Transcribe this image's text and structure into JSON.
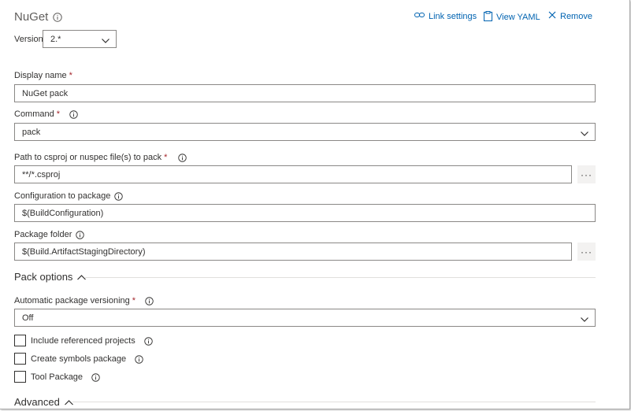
{
  "task": {
    "title": "NuGet",
    "actions": {
      "link_settings": "Link settings",
      "view_yaml": "View YAML",
      "remove": "Remove"
    },
    "version_label": "Version",
    "version_value": "2.*"
  },
  "fields": {
    "display_name": {
      "label": "Display name",
      "required": "*",
      "value": "NuGet pack"
    },
    "command": {
      "label": "Command",
      "required": "*",
      "value": "pack"
    },
    "path": {
      "label": "Path to csproj or nuspec file(s) to pack",
      "required": "*",
      "value": "**/*.csproj",
      "browse": "···"
    },
    "configuration": {
      "label": "Configuration to package",
      "value": "$(BuildConfiguration)"
    },
    "package_folder": {
      "label": "Package folder",
      "value": "$(Build.ArtifactStagingDirectory)",
      "browse": "···"
    }
  },
  "pack_options": {
    "title": "Pack options",
    "versioning": {
      "label": "Automatic package versioning",
      "required": "*",
      "value": "Off"
    },
    "checkboxes": [
      {
        "label": "Include referenced projects",
        "checked": false
      },
      {
        "label": "Create symbols package",
        "checked": false
      },
      {
        "label": "Tool Package",
        "checked": false
      }
    ]
  },
  "advanced": {
    "title": "Advanced"
  },
  "icons": {
    "info": "info-icon",
    "link": "link-icon",
    "yaml": "clipboard-icon",
    "remove": "close-icon",
    "dropdown": "chevron-down-icon",
    "collapse": "chevron-up-icon"
  },
  "colors": {
    "accent": "#0063b1",
    "required": "#a4262c",
    "border": "#8a8886"
  }
}
